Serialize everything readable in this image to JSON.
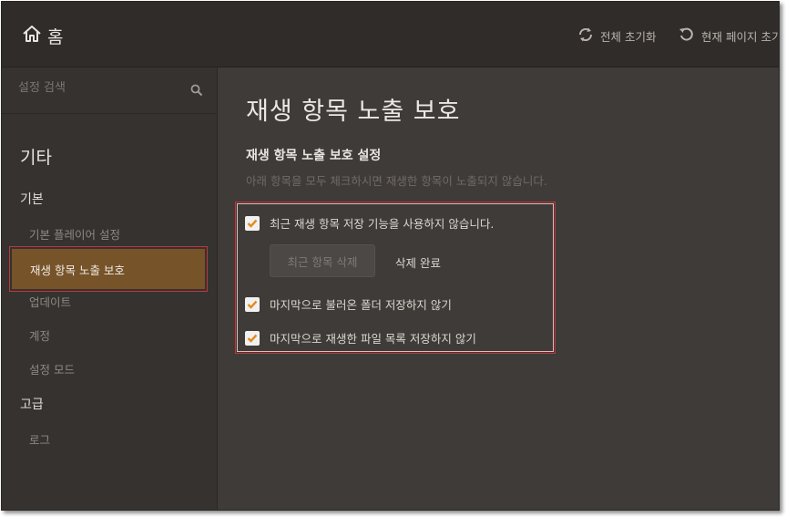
{
  "header": {
    "home_label": "홈",
    "reset_all_label": "전체 초기화",
    "reset_page_label": "현재 페이지 초기화"
  },
  "sidebar": {
    "search_placeholder": "설정 검색",
    "section_title": "기타",
    "group_basic": "기본",
    "items_basic": [
      "기본 플레이어 설정",
      "재생 항목 노출 보호",
      "업데이트",
      "계정",
      "설정 모드"
    ],
    "group_advanced": "고급",
    "items_advanced": [
      "로그"
    ]
  },
  "main": {
    "title": "재생 항목 노출 보호",
    "subtitle": "재생 항목 노출 보호 설정",
    "description": "아래 항목을 모두 체크하시면 재생한 항목이 노출되지 않습니다.",
    "option1": "최근 재생 항목 저장 기능을 사용하지 않습니다.",
    "delete_recent_button": "최근 항목 삭제",
    "delete_status": "삭제 완료",
    "option2": "마지막으로 불러온 폴더 저장하지 않기",
    "option3": "마지막으로 재생한 파일 목록 저장하지 않기"
  },
  "colors": {
    "accent": "#e58a1f",
    "active_item": "#765329",
    "highlight_border": "#c0363c"
  },
  "icons": [
    "home-icon",
    "refresh-icon",
    "reset-icon",
    "search-icon",
    "checkmark-icon"
  ]
}
